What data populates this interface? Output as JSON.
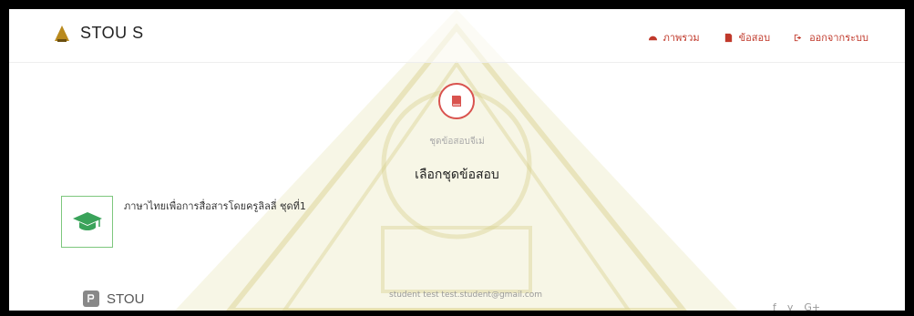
{
  "brand": {
    "name": "STOU S",
    "logo_icon": "stou-emblem-icon"
  },
  "nav": {
    "items": [
      {
        "label": "ภาพรวม",
        "icon": "dashboard-icon"
      },
      {
        "label": "ข้อสอบ",
        "icon": "file-icon"
      },
      {
        "label": "ออกจากระบบ",
        "icon": "sign-out-icon"
      }
    ]
  },
  "hero": {
    "icon": "book-icon",
    "caption": "ชุดข้อสอบจีเม่",
    "title": "เลือกชุดข้อสอบ"
  },
  "exam_sets": [
    {
      "title": "ภาษาไทยเพื่อการสื่อสารโดยครูลิลลี่ ชุดที่1",
      "icon": "graduation-cap-icon"
    }
  ],
  "footer": {
    "logo_text": "STOU",
    "user": "student test test.student@gmail.com",
    "social": [
      "f",
      "y",
      "G+"
    ]
  },
  "colors": {
    "accent": "#c0392b",
    "card_border": "#7dc77d",
    "cap": "#3aa35a"
  }
}
